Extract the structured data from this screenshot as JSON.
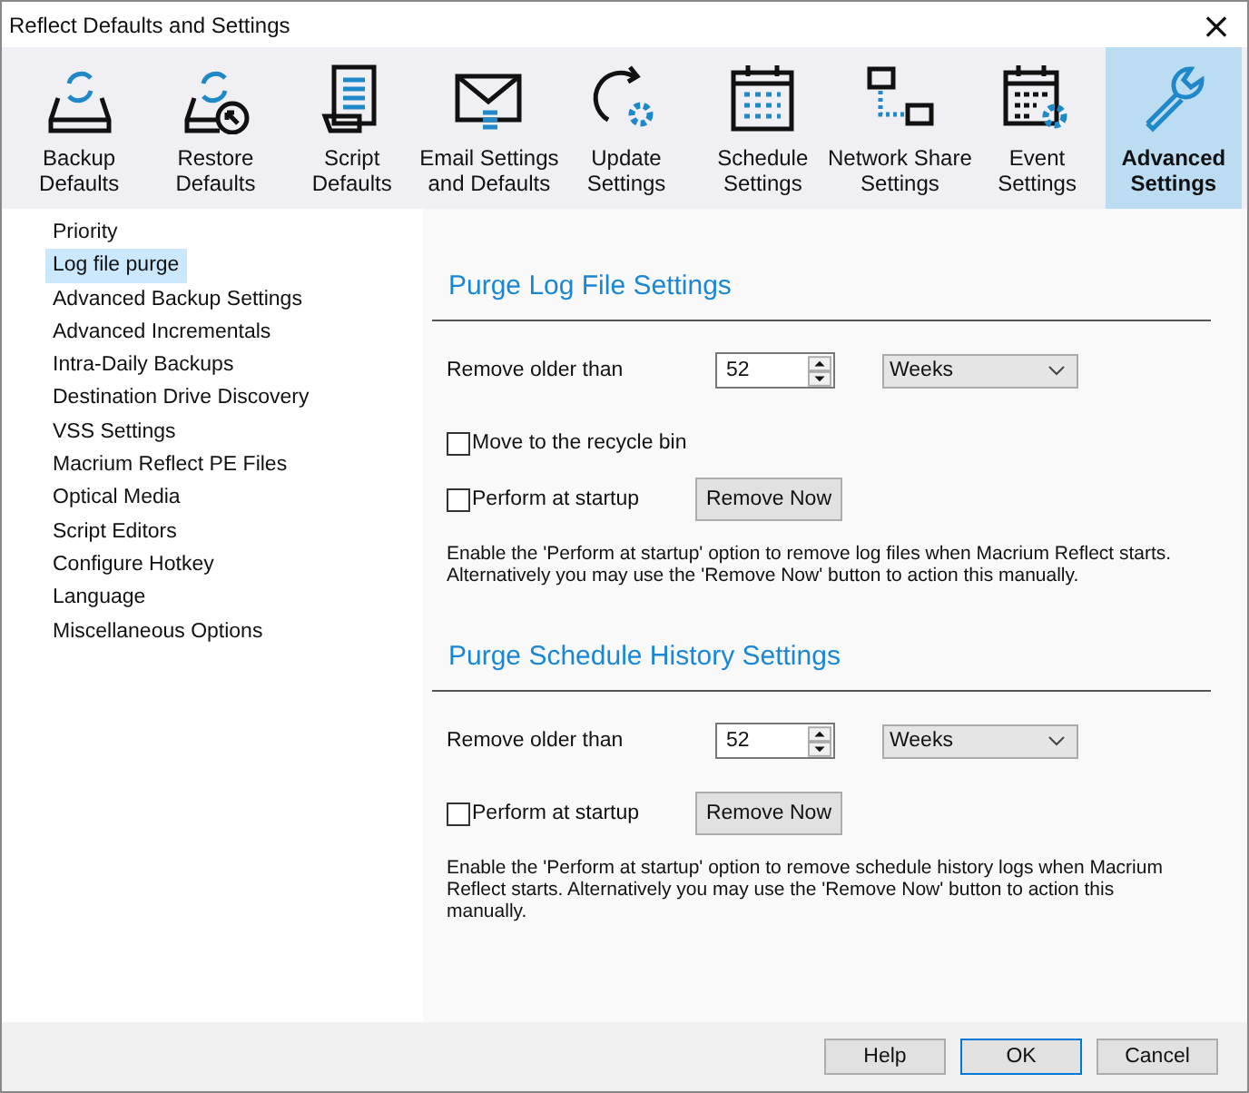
{
  "window": {
    "title": "Reflect Defaults and Settings",
    "close": "×"
  },
  "tabs": [
    {
      "lines": [
        "Backup",
        "Defaults"
      ],
      "selected": false
    },
    {
      "lines": [
        "Restore",
        "Defaults"
      ],
      "selected": false
    },
    {
      "lines": [
        "Script",
        "Defaults"
      ],
      "selected": false
    },
    {
      "lines": [
        "Email Settings",
        "and Defaults"
      ],
      "selected": false
    },
    {
      "lines": [
        "Update",
        "Settings"
      ],
      "selected": false
    },
    {
      "lines": [
        "Schedule",
        "Settings"
      ],
      "selected": false
    },
    {
      "lines": [
        "Network Share",
        "Settings"
      ],
      "selected": false
    },
    {
      "lines": [
        "Event",
        "Settings"
      ],
      "selected": false
    },
    {
      "lines": [
        "Advanced",
        "Settings"
      ],
      "selected": true
    }
  ],
  "sidebar": {
    "items": [
      {
        "label": "Priority",
        "selected": false
      },
      {
        "label": "Log file purge",
        "selected": true
      },
      {
        "label": "Advanced Backup Settings",
        "selected": false
      },
      {
        "label": "Advanced Incrementals",
        "selected": false
      },
      {
        "label": "Intra-Daily Backups",
        "selected": false
      },
      {
        "label": "Destination Drive Discovery",
        "selected": false
      },
      {
        "label": "VSS Settings",
        "selected": false
      },
      {
        "label": "Macrium Reflect PE Files",
        "selected": false
      },
      {
        "label": "Optical Media",
        "selected": false
      },
      {
        "label": "Script Editors",
        "selected": false
      },
      {
        "label": "Configure Hotkey",
        "selected": false
      },
      {
        "label": "Language",
        "selected": false
      },
      {
        "label": "Miscellaneous Options",
        "selected": false
      }
    ]
  },
  "sections": [
    {
      "title": "Purge Log File Settings",
      "remove_label": "Remove older than",
      "value": "52",
      "unit": "Weeks",
      "options": [
        {
          "label": "Move to the recycle bin",
          "checked": false
        },
        {
          "label": "Perform at startup",
          "checked": false,
          "button": "Remove Now"
        }
      ],
      "note": "Enable the 'Perform at startup' option to remove log files when Macrium Reflect starts. Alternatively you may use the 'Remove Now' button to action this manually."
    },
    {
      "title": "Purge Schedule History Settings",
      "remove_label": "Remove older than",
      "value": "52",
      "unit": "Weeks",
      "options": [
        {
          "label": "Perform at startup",
          "checked": false,
          "button": "Remove Now"
        }
      ],
      "note": "Enable the 'Perform at startup' option to remove schedule history logs when Macrium Reflect starts. Alternatively you may use the 'Remove Now' button to action this manually."
    }
  ],
  "buttons": [
    {
      "label": "Help",
      "default": false
    },
    {
      "label": "OK",
      "default": true
    },
    {
      "label": "Cancel",
      "default": false
    }
  ]
}
